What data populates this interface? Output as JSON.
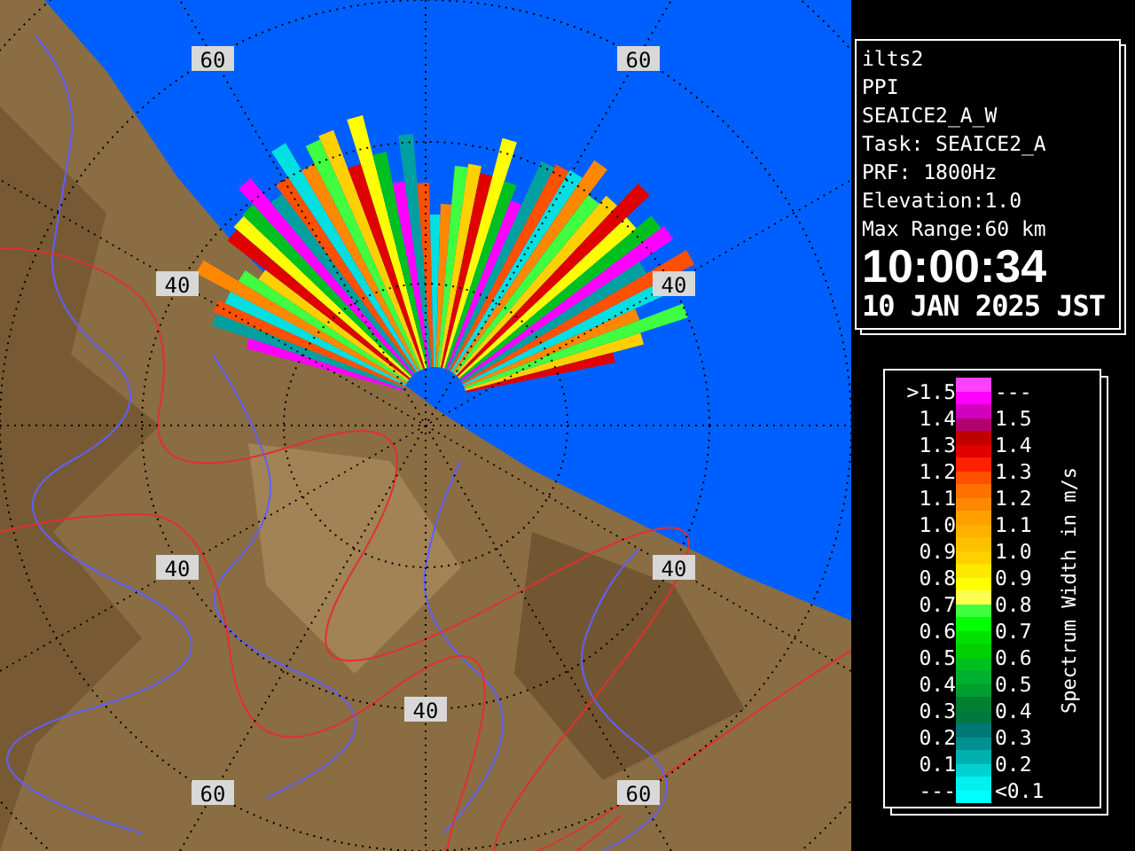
{
  "info": {
    "lines": [
      "ilts2",
      "PPI",
      "SEAICE2_A_W",
      "Task: SEAICE2_A",
      "PRF: 1800Hz",
      "Elevation:1.0",
      "Max Range:60 km"
    ],
    "time": "10:00:34",
    "date": "10 JAN 2025 JST"
  },
  "range_labels": [
    "60",
    "60",
    "40",
    "40",
    "40",
    "40",
    "40",
    "60",
    "60"
  ],
  "legend": {
    "title": "Spectrum Width in m/s",
    "rows": [
      {
        "low": ">1.5",
        "high": "---",
        "swatches": [
          {
            "color": "#ff40ff"
          },
          {
            "color": "#ff00ff"
          }
        ]
      },
      {
        "low": "1.4",
        "high": "1.5",
        "swatches": [
          {
            "color": "#d000c0"
          },
          {
            "color": "#b00070"
          }
        ]
      },
      {
        "low": "1.3",
        "high": "1.4",
        "swatches": [
          {
            "color": "#c00000"
          },
          {
            "color": "#e00000"
          }
        ]
      },
      {
        "low": "1.2",
        "high": "1.3",
        "swatches": [
          {
            "color": "#ff2000"
          },
          {
            "color": "#ff5000"
          }
        ]
      },
      {
        "low": "1.1",
        "high": "1.2",
        "swatches": [
          {
            "color": "#ff7000"
          },
          {
            "color": "#ff8800"
          }
        ]
      },
      {
        "low": "1.0",
        "high": "1.1",
        "swatches": [
          {
            "color": "#ffa000"
          },
          {
            "color": "#ffb000"
          }
        ]
      },
      {
        "low": "0.9",
        "high": "1.0",
        "swatches": [
          {
            "color": "#ffc000"
          },
          {
            "color": "#ffd000"
          }
        ]
      },
      {
        "low": "0.8",
        "high": "0.9",
        "swatches": [
          {
            "color": "#ffe800"
          },
          {
            "color": "#ffff00"
          }
        ]
      },
      {
        "low": "0.7",
        "high": "0.8",
        "swatches": [
          {
            "color": "#ffff50"
          },
          {
            "color": "#40ff40"
          }
        ]
      },
      {
        "low": "0.6",
        "high": "0.7",
        "swatches": [
          {
            "color": "#00ff00"
          },
          {
            "color": "#00e000"
          }
        ]
      },
      {
        "low": "0.5",
        "high": "0.6",
        "swatches": [
          {
            "color": "#00d000"
          },
          {
            "color": "#00c020"
          }
        ]
      },
      {
        "low": "0.4",
        "high": "0.5",
        "swatches": [
          {
            "color": "#00b030"
          },
          {
            "color": "#00a030"
          }
        ]
      },
      {
        "low": "0.3",
        "high": "0.4",
        "swatches": [
          {
            "color": "#008030"
          },
          {
            "color": "#007840"
          }
        ]
      },
      {
        "low": "0.2",
        "high": "0.3",
        "swatches": [
          {
            "color": "#007878"
          },
          {
            "color": "#009090"
          }
        ]
      },
      {
        "low": "0.1",
        "high": "0.2",
        "swatches": [
          {
            "color": "#00b0b0"
          },
          {
            "color": "#00d0d0"
          }
        ]
      },
      {
        "low": "---",
        "high": "<0.1",
        "swatches": [
          {
            "color": "#00f0f0"
          },
          {
            "color": "#00ffff"
          }
        ]
      }
    ]
  }
}
